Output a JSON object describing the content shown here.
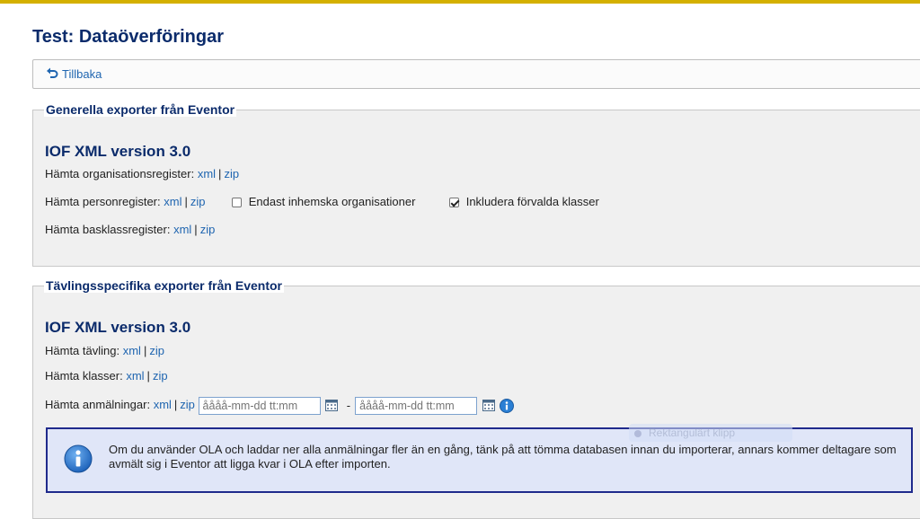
{
  "page": {
    "title": "Test: Dataöverföringar"
  },
  "back": {
    "label": "Tillbaka"
  },
  "colors": {
    "accent_bar": "#d4b000",
    "heading": "#0b2b6b",
    "link": "#1f65b0",
    "notice_border": "#1f2a8c",
    "notice_bg": "#e0e6f8"
  },
  "general": {
    "legend": "Generella exporter från Eventor",
    "heading": "IOF XML version 3.0",
    "org_label": "Hämta organisationsregister:",
    "person_label": "Hämta personregister:",
    "base_label": "Hämta basklassregister:",
    "opt_domestic": {
      "label": "Endast inhemska organisationer",
      "checked": false
    },
    "opt_default_classes": {
      "label": "Inkludera förvalda klasser",
      "checked": true
    }
  },
  "links": {
    "xml": "xml",
    "zip": "zip",
    "sep": "|"
  },
  "event": {
    "legend": "Tävlingsspecifika exporter från Eventor",
    "heading": "IOF XML version 3.0",
    "competition_label": "Hämta tävling:",
    "classes_label": "Hämta klasser:",
    "entries_label": "Hämta anmälningar:",
    "date_from_placeholder": "åååå-mm-dd tt:mm",
    "date_to_placeholder": "åååå-mm-dd tt:mm",
    "date_sep": "-",
    "notice": "Om du använder OLA och laddar ner alla anmälningar fler än en gång, tänk på att tömma databasen innan du importerar, annars kommer deltagare som avmält sig i Eventor att ligga kvar i OLA efter importen."
  },
  "overlay": {
    "ghost_label": "Rektangulärt klipp"
  },
  "icons": {
    "back": "undo-arrow-icon",
    "calendar": "calendar-icon",
    "info": "info-icon"
  }
}
